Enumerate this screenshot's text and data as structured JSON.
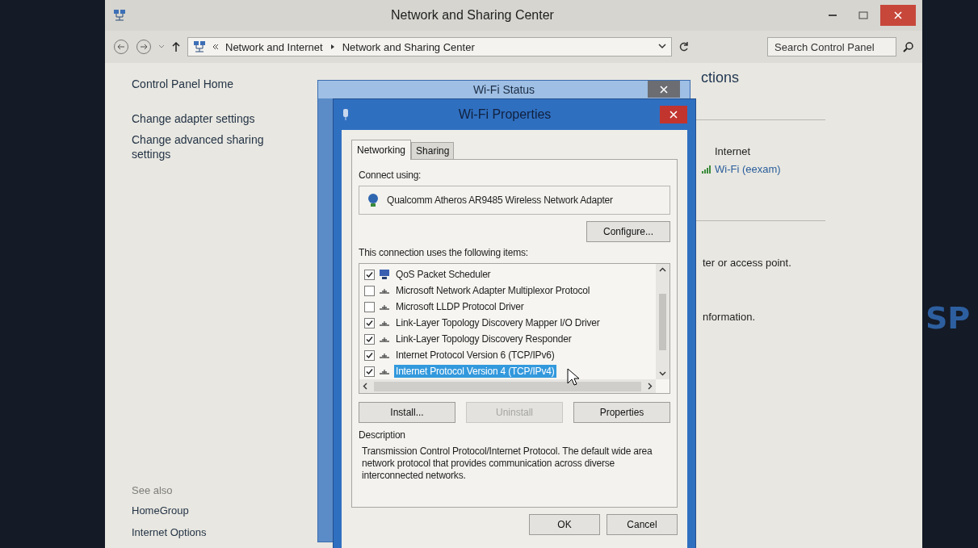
{
  "window": {
    "title": "Network and Sharing Center"
  },
  "address_bar": {
    "breadcrumbs": [
      "Network and Internet",
      "Network and Sharing Center"
    ],
    "search": {
      "placeholder": "Search Control Panel"
    }
  },
  "sidebar": {
    "items": [
      "Control Panel Home",
      "Change adapter settings",
      "Change advanced sharing settings"
    ],
    "see_also_heading": "See also",
    "see_also": [
      "HomeGroup",
      "Internet Options"
    ]
  },
  "main": {
    "heading": "ctions",
    "network_label": "Internet",
    "network_link": "Wi-Fi (eexam)",
    "texts": [
      "ter or access point.",
      "nformation."
    ]
  },
  "status_dialog": {
    "title": "Wi-Fi Status"
  },
  "desktop": {
    "wallpaper_text": "SP"
  },
  "properties_dialog": {
    "title": "Wi-Fi Properties",
    "tabs": [
      {
        "label": "Networking",
        "selected": true
      },
      {
        "label": "Sharing",
        "selected": false
      }
    ],
    "connect_using_label": "Connect using:",
    "adapter": "Qualcomm Atheros AR9485 Wireless Network Adapter",
    "configure_button": "Configure...",
    "items_label": "This connection uses the following items:",
    "items": [
      {
        "kind": "service",
        "label": "QoS Packet Scheduler",
        "checked": true,
        "selected": false
      },
      {
        "kind": "protocol",
        "label": "Microsoft Network Adapter Multiplexor Protocol",
        "checked": false,
        "selected": false
      },
      {
        "kind": "protocol",
        "label": "Microsoft LLDP Protocol Driver",
        "checked": false,
        "selected": false
      },
      {
        "kind": "protocol",
        "label": "Link-Layer Topology Discovery Mapper I/O Driver",
        "checked": true,
        "selected": false
      },
      {
        "kind": "protocol",
        "label": "Link-Layer Topology Discovery Responder",
        "checked": true,
        "selected": false
      },
      {
        "kind": "protocol",
        "label": "Internet Protocol Version 6 (TCP/IPv6)",
        "checked": true,
        "selected": false
      },
      {
        "kind": "protocol",
        "label": "Internet Protocol Version 4 (TCP/IPv4)",
        "checked": true,
        "selected": true
      }
    ],
    "buttons": [
      {
        "label": "Install...",
        "disabled": false
      },
      {
        "label": "Uninstall",
        "disabled": true
      },
      {
        "label": "Properties",
        "disabled": false
      }
    ],
    "description_label": "Description",
    "description": "Transmission Control Protocol/Internet Protocol. The default wide area network protocol that provides communication across diverse interconnected networks.",
    "footer_buttons": [
      "OK",
      "Cancel"
    ]
  }
}
